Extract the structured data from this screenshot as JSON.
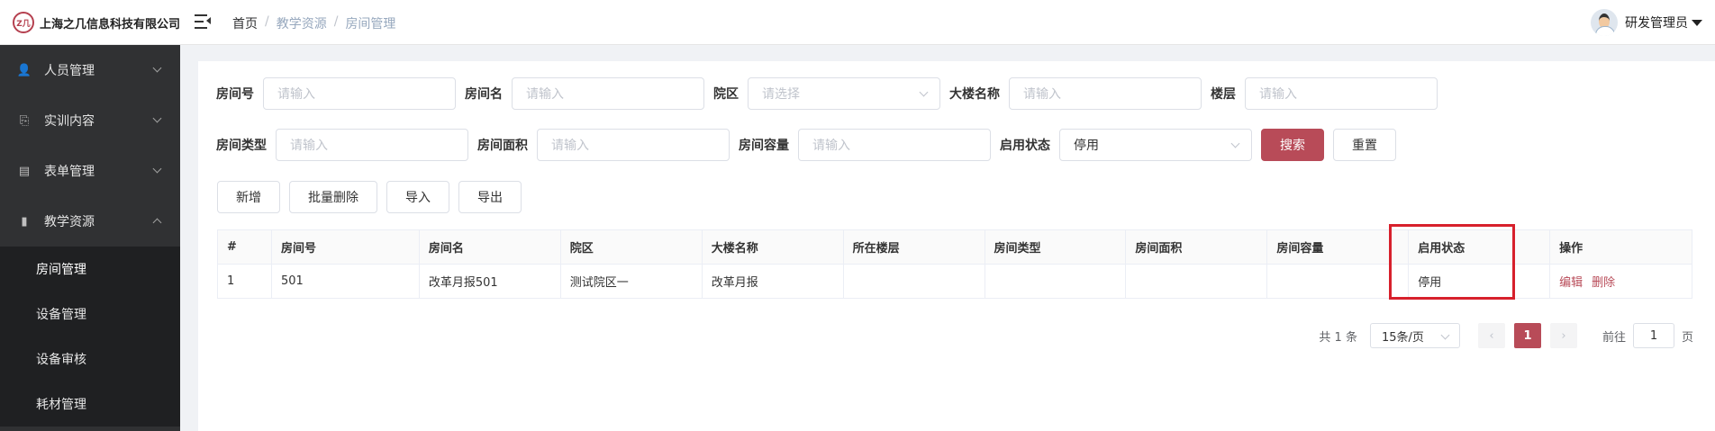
{
  "header": {
    "logo_mark": "Z几",
    "company": "上海之几信息科技有限公司",
    "breadcrumb": [
      "首页",
      "教学资源",
      "房间管理"
    ],
    "user_name": "研发管理员"
  },
  "sidebar": {
    "menus": [
      {
        "label": "人员管理",
        "icon": "person-icon",
        "glyph": "👤"
      },
      {
        "label": "实训内容",
        "icon": "content-icon",
        "glyph": "⎘"
      },
      {
        "label": "表单管理",
        "icon": "form-icon",
        "glyph": "▤"
      },
      {
        "label": "教学资源",
        "icon": "resource-icon",
        "glyph": "▮"
      }
    ],
    "submenu": [
      "房间管理",
      "设备管理",
      "设备审核",
      "耗材管理"
    ]
  },
  "filters": {
    "room_no": {
      "label": "房间号",
      "placeholder": "请输入"
    },
    "room_name": {
      "label": "房间名",
      "placeholder": "请输入"
    },
    "campus": {
      "label": "院区",
      "placeholder": "请选择"
    },
    "building": {
      "label": "大楼名称",
      "placeholder": "请输入"
    },
    "floor": {
      "label": "楼层",
      "placeholder": "请输入"
    },
    "room_type": {
      "label": "房间类型",
      "placeholder": "请输入"
    },
    "room_area": {
      "label": "房间面积",
      "placeholder": "请输入"
    },
    "room_capacity": {
      "label": "房间容量",
      "placeholder": "请输入"
    },
    "status": {
      "label": "启用状态",
      "value": "停用"
    },
    "search_label": "搜索",
    "reset_label": "重置"
  },
  "toolbar": {
    "add": "新增",
    "batch_delete": "批量删除",
    "import": "导入",
    "export": "导出"
  },
  "table": {
    "columns": [
      "#",
      "房间号",
      "房间名",
      "院区",
      "大楼名称",
      "所在楼层",
      "房间类型",
      "房间面积",
      "房间容量",
      "启用状态",
      "操作"
    ],
    "rows": [
      {
        "index": "1",
        "room_no": "501",
        "room_name": "改革月报501",
        "campus": "测试院区一",
        "building": "改革月报",
        "floor": "",
        "type": "",
        "area": "",
        "capacity": "",
        "status": "停用",
        "edit": "编辑",
        "delete": "删除"
      }
    ]
  },
  "pagination": {
    "total": "共 1 条",
    "page_size": "15条/页",
    "prev": "‹",
    "next": "›",
    "current": "1",
    "goto_prefix": "前往",
    "goto_value": "1",
    "goto_suffix": "页"
  }
}
